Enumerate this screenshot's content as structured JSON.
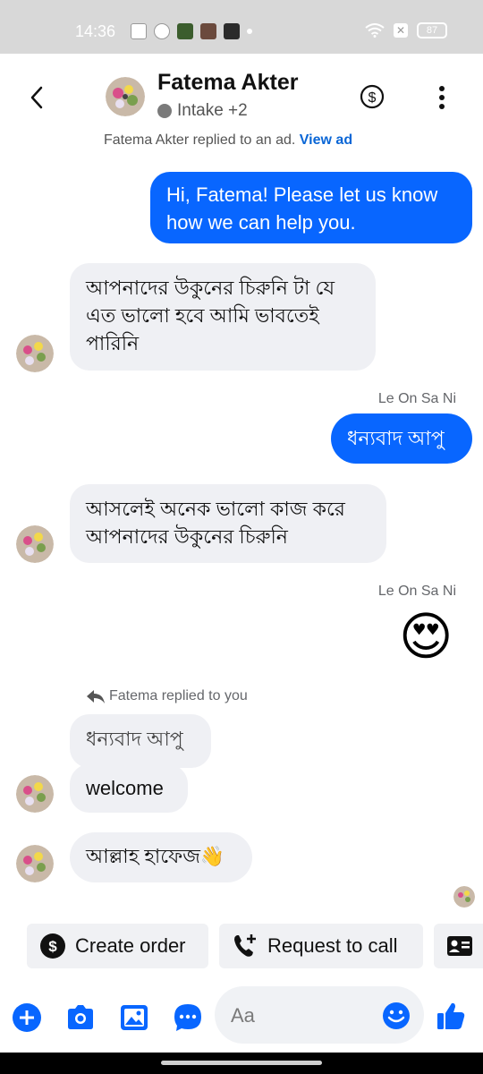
{
  "status_bar": {
    "time": "14:36",
    "battery": "87",
    "icons": [
      "notification-icon",
      "sync-icon",
      "app-icon-1",
      "app-icon-2",
      "app-icon-3",
      "dot",
      "wifi-icon",
      "x-icon",
      "battery-icon"
    ]
  },
  "header": {
    "name": "Fatema Akter",
    "subtitle": "Intake +2",
    "back_icon": "chevron-left-icon",
    "payment_icon": "dollar-circle-icon",
    "more_icon": "more-vertical-icon"
  },
  "referral": {
    "text": "Fatema Akter replied to an ad.",
    "link": "View ad"
  },
  "messages": [
    {
      "direction": "out",
      "text": "Hi, Fatema! Please let us know how we can help you."
    },
    {
      "direction": "in",
      "text": "আপনাদের উকুনের চিরুনি টা যে এত ভালো হবে আমি  ভাবতেই পারিনি"
    },
    {
      "direction": "meta",
      "text": "Le On Sa Ni"
    },
    {
      "direction": "out",
      "text": "ধন্যবাদ আপু"
    },
    {
      "direction": "in",
      "text": "আসলেই অনেক ভালো কাজ করে আপনাদের উকুনের চিরুনি"
    },
    {
      "direction": "meta",
      "text": "Le On Sa Ni"
    },
    {
      "direction": "out-emoji",
      "text": "😍"
    },
    {
      "direction": "reply-meta",
      "text": "Fatema replied to you"
    },
    {
      "direction": "in-quoted",
      "text": "ধন্যবাদ আপু"
    },
    {
      "direction": "in",
      "text": "welcome"
    },
    {
      "direction": "in",
      "text": "আল্লাহ হাফেজ👋"
    }
  ],
  "actions": [
    {
      "label": "Create order",
      "icon": "dollar-circle-icon"
    },
    {
      "label": "Request to call",
      "icon": "phone-plus-icon"
    },
    {
      "label": "",
      "icon": "contact-card-icon"
    }
  ],
  "composer": {
    "placeholder": "Aa",
    "icons": [
      "plus-circle-icon",
      "camera-icon",
      "gallery-icon",
      "chat-bubble-icon",
      "emoji-icon",
      "thumbs-up-icon"
    ]
  },
  "colors": {
    "accent": "#0866ff",
    "incoming_bubble": "#eff0f4",
    "link": "#0a66d6"
  }
}
